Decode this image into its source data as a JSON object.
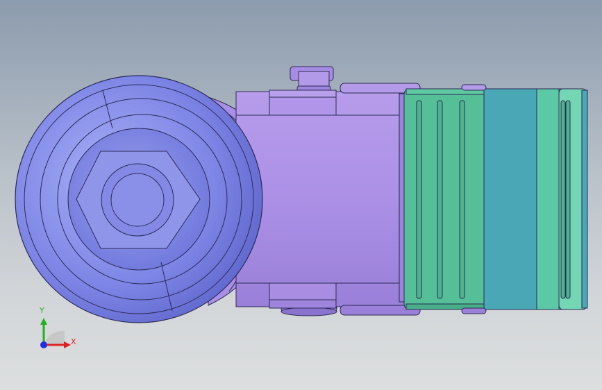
{
  "app": {
    "title": ""
  },
  "viewport": {
    "background_top": "#8c9bad",
    "background_bottom": "#dcdedf"
  },
  "model": {
    "wheel_color": "#7e86e6",
    "wheel_highlight": "#9ea6f2",
    "body_color": "#ab90e6",
    "body_shadow": "#9a7fd8",
    "guard_green": "#55bf98",
    "guard_blue": "#4aa7b6",
    "guard_mint": "#74d6b4",
    "edge_color": "#2a2a55"
  },
  "triad": {
    "x_label": "X",
    "y_label": "Y",
    "x_color": "#e02020",
    "y_color": "#20b020",
    "z_color": "#2030e0"
  }
}
